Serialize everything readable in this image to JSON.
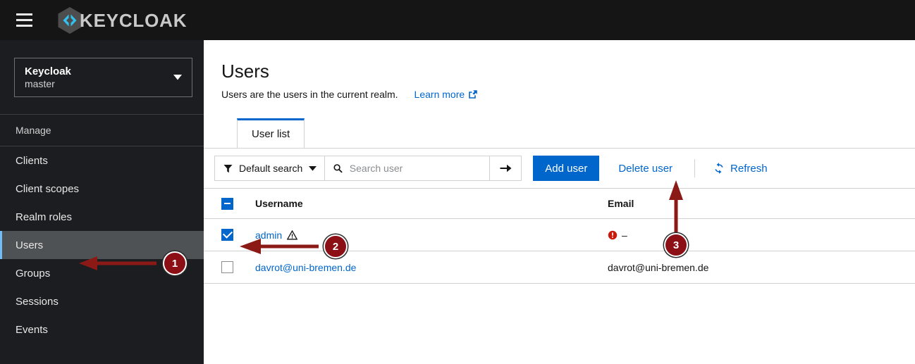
{
  "masthead": {
    "menu_toggle_name": "Global navigation",
    "brand_text": "KEYCLOAK"
  },
  "sidebar": {
    "realm": {
      "name": "Keycloak",
      "sub": "master"
    },
    "section_label": "Manage",
    "items": [
      {
        "label": "Clients",
        "current": false
      },
      {
        "label": "Client scopes",
        "current": false
      },
      {
        "label": "Realm roles",
        "current": false
      },
      {
        "label": "Users",
        "current": true
      },
      {
        "label": "Groups",
        "current": false
      },
      {
        "label": "Sessions",
        "current": false
      },
      {
        "label": "Events",
        "current": false
      }
    ]
  },
  "page": {
    "title": "Users",
    "description": "Users are the users in the current realm.",
    "learn_more": "Learn more"
  },
  "tabs": [
    {
      "label": "User list",
      "active": true
    }
  ],
  "toolbar": {
    "filter_label": "Default search",
    "search_placeholder": "Search user",
    "search_value": "",
    "add_user_label": "Add user",
    "delete_user_label": "Delete user",
    "refresh_label": "Refresh"
  },
  "table": {
    "columns": [
      "Username",
      "Email"
    ],
    "select_all_state": "indeterminate",
    "rows": [
      {
        "selected": true,
        "username": "admin",
        "username_warning": true,
        "email": "–",
        "email_error": true
      },
      {
        "selected": false,
        "username": "davrot@uni-bremen.de",
        "username_warning": false,
        "email": "davrot@uni-bremen.de",
        "email_error": false
      }
    ]
  },
  "annotations": [
    {
      "number": "1"
    },
    {
      "number": "2"
    },
    {
      "number": "3"
    }
  ],
  "colors": {
    "masthead_bg": "#151515",
    "sidebar_bg": "#1b1d21",
    "accent_blue": "#0066cc",
    "nav_active_bg": "#4f5255",
    "nav_active_border": "#73bcf7",
    "annotation_red": "#8b0f14",
    "error_red": "#c9190b"
  }
}
